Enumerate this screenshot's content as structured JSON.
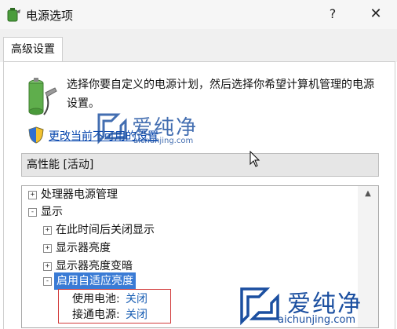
{
  "window": {
    "title": "电源选项",
    "help_label": "?",
    "close_label": "✕"
  },
  "tabs": [
    {
      "label": "高级设置",
      "selected": true
    }
  ],
  "description": {
    "text": "选择你要自定义的电源计划，然后选择你希望计算机管理的电源设置。"
  },
  "change_settings_link": {
    "text": "更改当前不可用的设置"
  },
  "plan_dropdown": {
    "selected": "高性能 [活动]"
  },
  "tree": {
    "items": [
      {
        "toggle": "+",
        "label": "处理器电源管理"
      },
      {
        "toggle": "-",
        "label": "显示"
      },
      {
        "toggle": "+",
        "label": "在此时间后关闭显示"
      },
      {
        "toggle": "+",
        "label": "显示器亮度"
      },
      {
        "toggle": "+",
        "label": "显示器亮度变暗"
      },
      {
        "toggle": "-",
        "label": "启用自适应亮度"
      }
    ],
    "settings": [
      {
        "label": "使用电池:",
        "value": "关闭"
      },
      {
        "label": "接通电源:",
        "value": "关闭"
      }
    ]
  },
  "watermark": {
    "text_cn": "爱纯净",
    "url": "aichunjing.com"
  },
  "colors": {
    "accent": "#3a7bd5",
    "link": "#0645ad",
    "highlight_box": "#d23c3c",
    "watermark": "#1b4fa0"
  },
  "icons": {
    "app": "power-options-icon",
    "battery": "battery-plug-icon",
    "shield": "uac-shield-icon"
  }
}
